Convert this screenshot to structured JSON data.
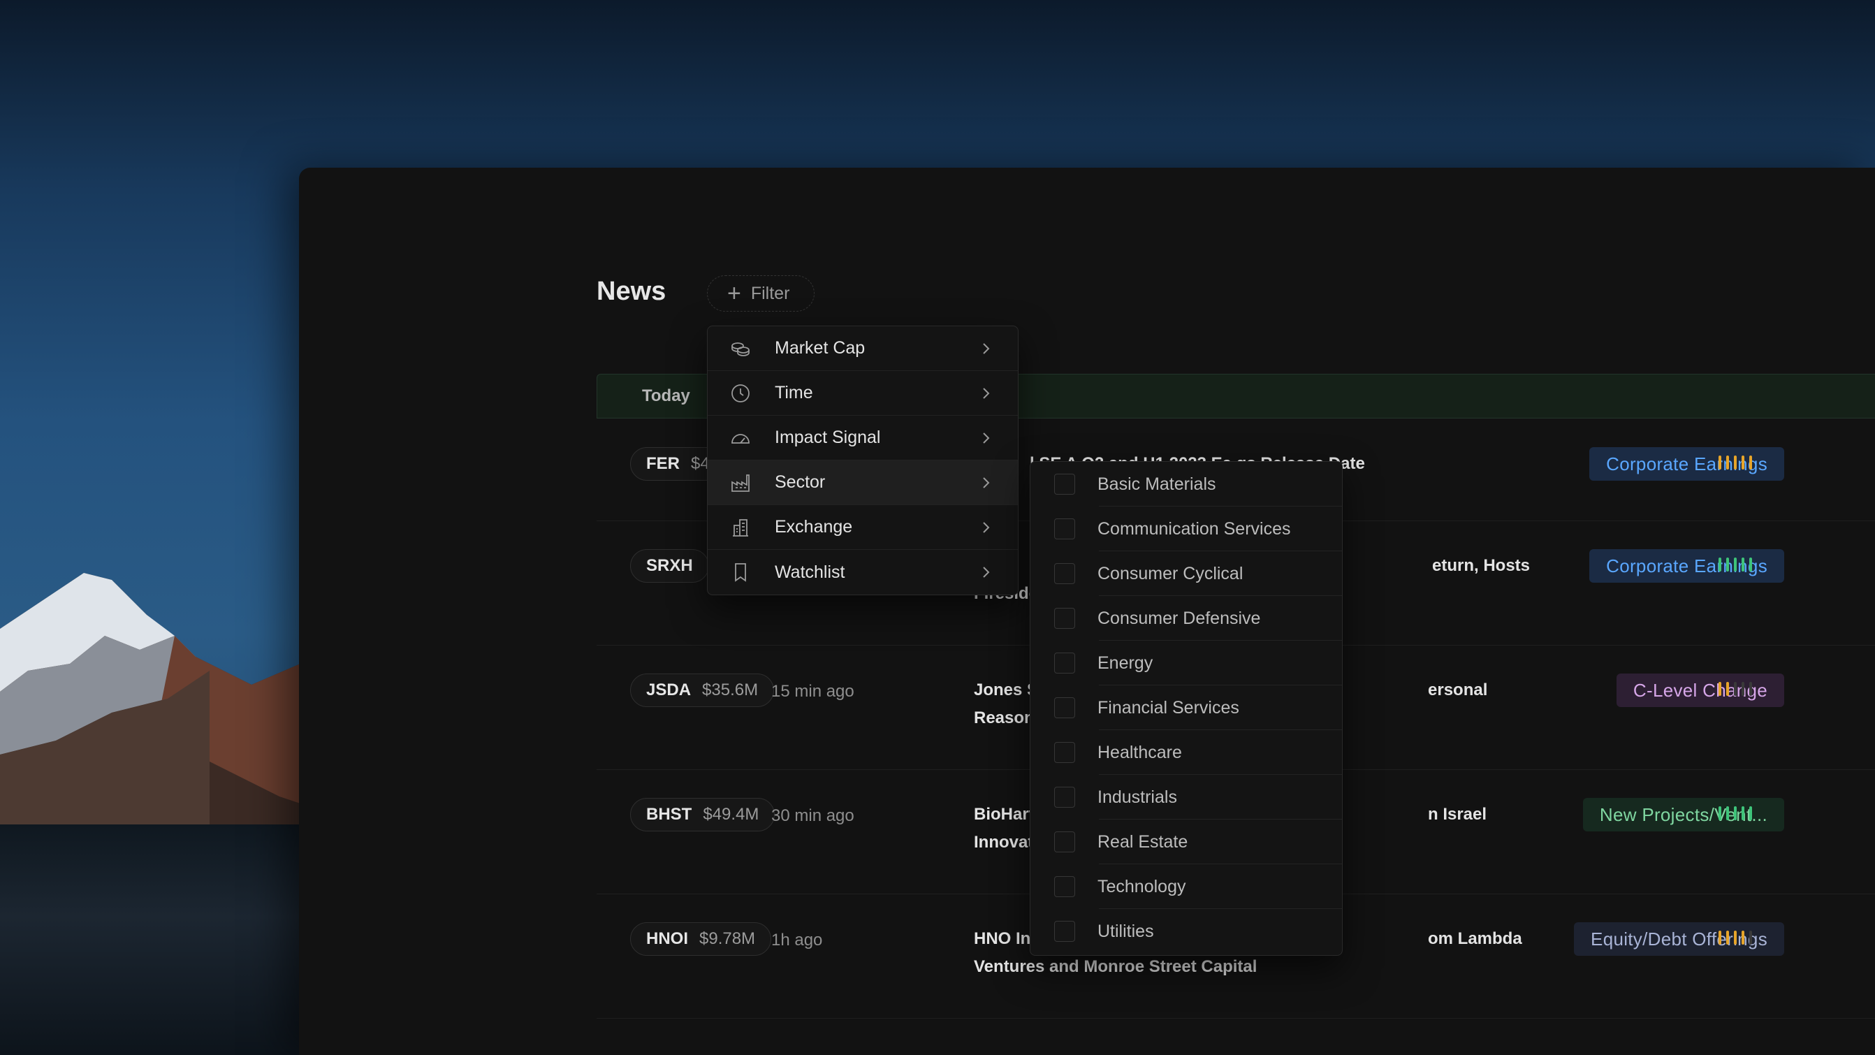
{
  "page": {
    "title": "News",
    "filter_label": "Filter"
  },
  "table": {
    "group_label": "Today",
    "rows": [
      {
        "symbol": "FER",
        "cap": "$4",
        "time": "",
        "headline": "",
        "headline_tail": "",
        "tag": "Corporate Earnings",
        "tag_color": "#5aa7ff",
        "tag_bg": "#1b2b44",
        "signal_level": 5,
        "signal_color": "#e7a52a"
      },
      {
        "symbol": "SRXH",
        "cap": "",
        "time": "",
        "headline": "",
        "headline_tail": "",
        "tag": "Corporate Earnings",
        "tag_color": "#5aa7ff",
        "tag_bg": "#1b2b44",
        "signal_level": 5,
        "signal_color": "#3ec47a"
      },
      {
        "symbol": "JSDA",
        "cap": "$35.6M",
        "time": "15 min ago",
        "headline": "Jones So\nReasons",
        "headline_tail": "ersonal",
        "tag": "C-Level Change",
        "tag_color": "#d6a6e8",
        "tag_bg": "#2d1f33",
        "signal_level": 2,
        "signal_color": "#e7a52a"
      },
      {
        "symbol": "BHST",
        "cap": "$49.4M",
        "time": "30 min ago",
        "headline": "BioHarve\nInnovatio",
        "headline_tail": "n Israel",
        "tag": "New Projects/Vent...",
        "tag_color": "#7fd6a0",
        "tag_bg": "#16291f",
        "signal_level": 5,
        "signal_color": "#3ec47a"
      },
      {
        "symbol": "HNOI",
        "cap": "$9.78M",
        "time": "1h ago",
        "headline": "HNO Inter\nVentures and Monroe Street Capital",
        "headline_tail": "om Lambda",
        "tag": "Equity/Debt Offerings",
        "tag_color": "#a9b4d6",
        "tag_bg": "#1d2230",
        "signal_level": 4,
        "signal_color": "#e7a52a"
      }
    ],
    "partial_texts": {
      "row1_fragment": "l SE A          Q2 and H1 2023 Ea      gs Release Date",
      "row2_fragment_a": "b",
      "row2_fragment_b": "Fireside C",
      "row2_fragment_c": "eturn, Hosts"
    }
  },
  "menu": {
    "items": [
      {
        "label": "Market Cap",
        "icon": "coins-icon"
      },
      {
        "label": "Time",
        "icon": "clock-icon"
      },
      {
        "label": "Impact Signal",
        "icon": "gauge-icon"
      },
      {
        "label": "Sector",
        "icon": "factory-icon",
        "active": true
      },
      {
        "label": "Exchange",
        "icon": "building-icon"
      },
      {
        "label": "Watchlist",
        "icon": "bookmark-icon"
      }
    ]
  },
  "sector_options": [
    "Basic Materials",
    "Communication Services",
    "Consumer Cyclical",
    "Consumer Defensive",
    "Energy",
    "Financial Services",
    "Healthcare",
    "Industrials",
    "Real Estate",
    "Technology",
    "Utilities"
  ]
}
